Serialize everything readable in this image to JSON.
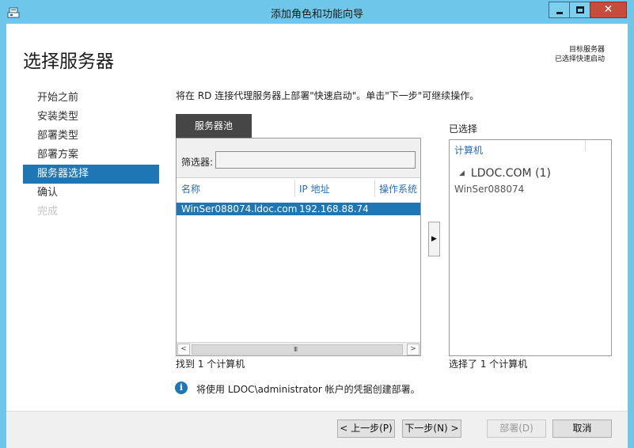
{
  "window": {
    "title": "添加角色和功能向导",
    "close_glyph": "✕"
  },
  "page": {
    "title": "选择服务器",
    "destination_label": "目标服务器",
    "destination_value": "已选择快速启动"
  },
  "nav": {
    "items": [
      {
        "label": "开始之前",
        "state": "normal"
      },
      {
        "label": "安装类型",
        "state": "normal"
      },
      {
        "label": "部署类型",
        "state": "normal"
      },
      {
        "label": "部署方案",
        "state": "normal"
      },
      {
        "label": "服务器选择",
        "state": "active"
      },
      {
        "label": "确认",
        "state": "normal"
      },
      {
        "label": "完成",
        "state": "disabled"
      }
    ]
  },
  "content": {
    "instruction": "将在 RD 连接代理服务器上部署\"快速启动\"。单击\"下一步\"可继续操作。",
    "pool_tab": "服务器池",
    "filter_label": "筛选器:",
    "filter_value": "",
    "columns": [
      "名称",
      "IP 地址",
      "操作系统"
    ],
    "rows": [
      {
        "name": "WinSer088074.ldoc.com",
        "ip": "192.168.88.74",
        "os": ""
      }
    ],
    "found_text": "找到 1 个计算机",
    "scroll_left": "<",
    "scroll_right": ">",
    "scroll_grip": "III",
    "add_glyph": "▶"
  },
  "selected": {
    "title": "已选择",
    "column": "计算机",
    "group_label": "LDOC.COM (1)",
    "group_glyph": "◢",
    "items": [
      "WinSer088074"
    ],
    "count_text": "选择了 1 个计算机"
  },
  "info": {
    "icon_glyph": "i",
    "text": "将使用 LDOC\\administrator 帐户的凭据创建部署。"
  },
  "footer": {
    "prev_label": "< 上一步(P)",
    "next_label": "下一步(N) >",
    "deploy_label": "部署(D)",
    "cancel_label": "取消"
  },
  "colors": {
    "titlebar": "#6ec7ea",
    "accent": "#1e76b4",
    "close": "#c74c3c",
    "link_blue": "#2a6fb5"
  }
}
